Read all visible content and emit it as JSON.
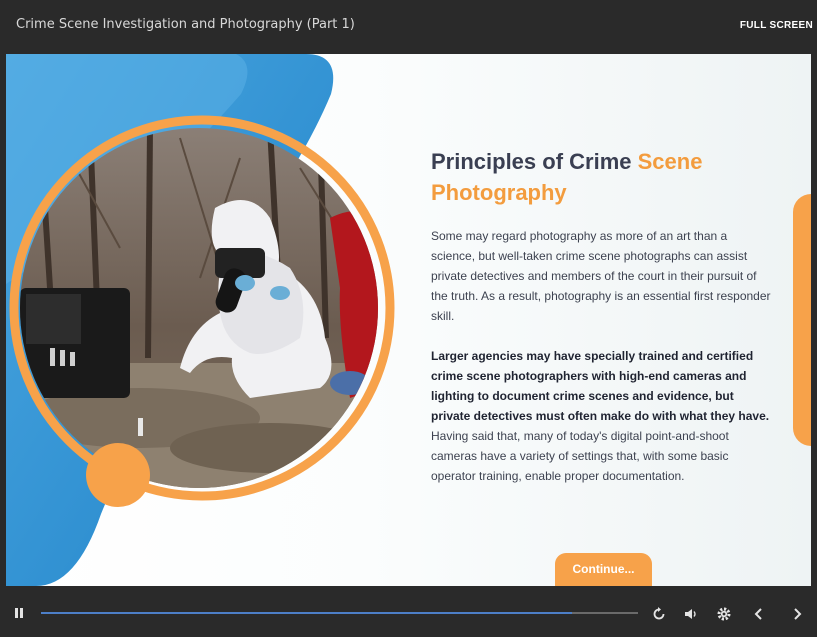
{
  "header": {
    "course_title": "Crime Scene Investigation and Photography (Part 1)",
    "fullscreen_label": "FULL SCREEN"
  },
  "slide": {
    "heading_main": "Principles of Crime ",
    "heading_accent": "Scene Photography",
    "paragraph1": "Some may regard photography as more of an art than a science, but well-taken crime scene photographs can assist private detectives and members of the court in their pursuit of the truth. As a result, photography is an essential first responder skill.",
    "paragraph2_bold": "Larger agencies may have specially trained and certified crime scene photographers with high-end cameras and lighting to document crime scenes and evidence, but private detectives must often make do with what they have.",
    "paragraph2_rest": " Having said that, many of today's digital point-and-shoot cameras have a variety of settings that, with some basic operator training, enable proper documentation.",
    "continue_label": "Continue...",
    "colors": {
      "blue": "#2d8fd0",
      "orange": "#f7a24a",
      "heading": "#3a3f52"
    }
  },
  "controls": {
    "progress_fraction": 0.89,
    "icons": [
      "pause-icon",
      "replay-icon",
      "volume-icon",
      "gear-icon",
      "chevron-left-icon",
      "chevron-right-icon"
    ]
  }
}
